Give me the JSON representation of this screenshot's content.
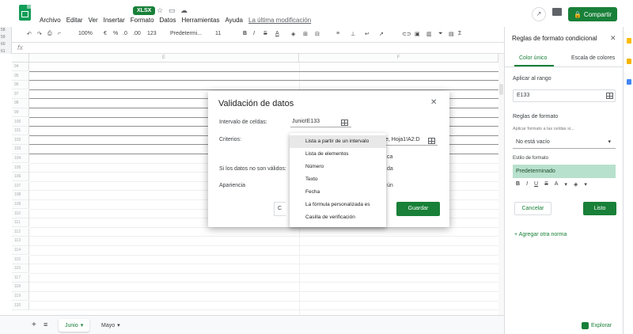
{
  "header": {
    "xlsx_badge": "XLSX",
    "menu": [
      "Archivo",
      "Editar",
      "Ver",
      "Insertar",
      "Formato",
      "Datos",
      "Herramientas",
      "Ayuda"
    ],
    "last_edit": "La última modificación",
    "share_label": "Compartir"
  },
  "toolbar": {
    "zoom": "100%",
    "currency": "€",
    "percent": "%",
    "dec1": ".0",
    "dec2": ".00",
    "format123": "123",
    "font": "Predetermi...",
    "font_size": "11"
  },
  "grid": {
    "columns": [
      "E",
      "F"
    ],
    "rows": [
      "94",
      "95",
      "96",
      "97",
      "98",
      "99",
      "100",
      "101",
      "102",
      "103",
      "104",
      "105",
      "106",
      "107",
      "108",
      "109",
      "110",
      "111",
      "112",
      "113",
      "114",
      "115",
      "116",
      "117",
      "118",
      "119",
      "120"
    ],
    "outer_rows": [
      "58",
      "59",
      "60",
      "61",
      "62",
      "63",
      "64",
      "65",
      "66",
      "67",
      "68",
      "69",
      "70",
      "71",
      "72",
      "73",
      "74",
      "75",
      "76",
      "77",
      "78",
      "79",
      "80",
      "81",
      "82",
      "83",
      "84",
      "85",
      "86",
      "87",
      "88",
      "89",
      "90",
      "91",
      "92",
      "93",
      "94",
      "95",
      "96",
      "97"
    ]
  },
  "sheets": {
    "add": "+",
    "list": "≡",
    "tabs": [
      {
        "label": "Junio",
        "active": true
      },
      {
        "label": "Mayo",
        "active": false
      }
    ],
    "explore": "Explorar"
  },
  "dialog": {
    "title": "Validación de datos",
    "range_label": "Intervalo de celdas:",
    "range_value": "Junio!E133",
    "criteria_label": "Criterios:",
    "criteria_suffix": "e, Hoja1!A2:D",
    "invalid_label": "Si los datos no son válidos:",
    "invalid_suffix": "da",
    "appearance_label": "Apariencia",
    "appearance_suffix": "ún",
    "ellipsis_snippet": "ca",
    "cancel_part": "C",
    "save": "Guardar"
  },
  "dropdown": {
    "items": [
      "Lista a partir de un intervalo",
      "Lista de elementos",
      "Número",
      "Texto",
      "Fecha",
      "La fórmula personalizada es",
      "Casilla de verificación"
    ],
    "selected_index": 0
  },
  "panel": {
    "title": "Reglas de formato condicional",
    "tab_single": "Color único",
    "tab_scale": "Escala de colores",
    "apply_label": "Aplicar al rango",
    "range_value": "E133",
    "rules_label": "Reglas de formato",
    "condition_hint": "Aplicar formato a las celdas si...",
    "condition_value": "No está vacío",
    "style_label": "Estilo de formato",
    "style_value": "Predeterminado",
    "format_buttons": [
      "B",
      "I",
      "U",
      "S",
      "A",
      "▾",
      "◈",
      "▾"
    ],
    "cancel": "Cancelar",
    "done": "Listo",
    "add_rule": "+ Agregar otra norma"
  },
  "colors": {
    "accent": "#188038",
    "style_fill": "#b7e1cd"
  }
}
